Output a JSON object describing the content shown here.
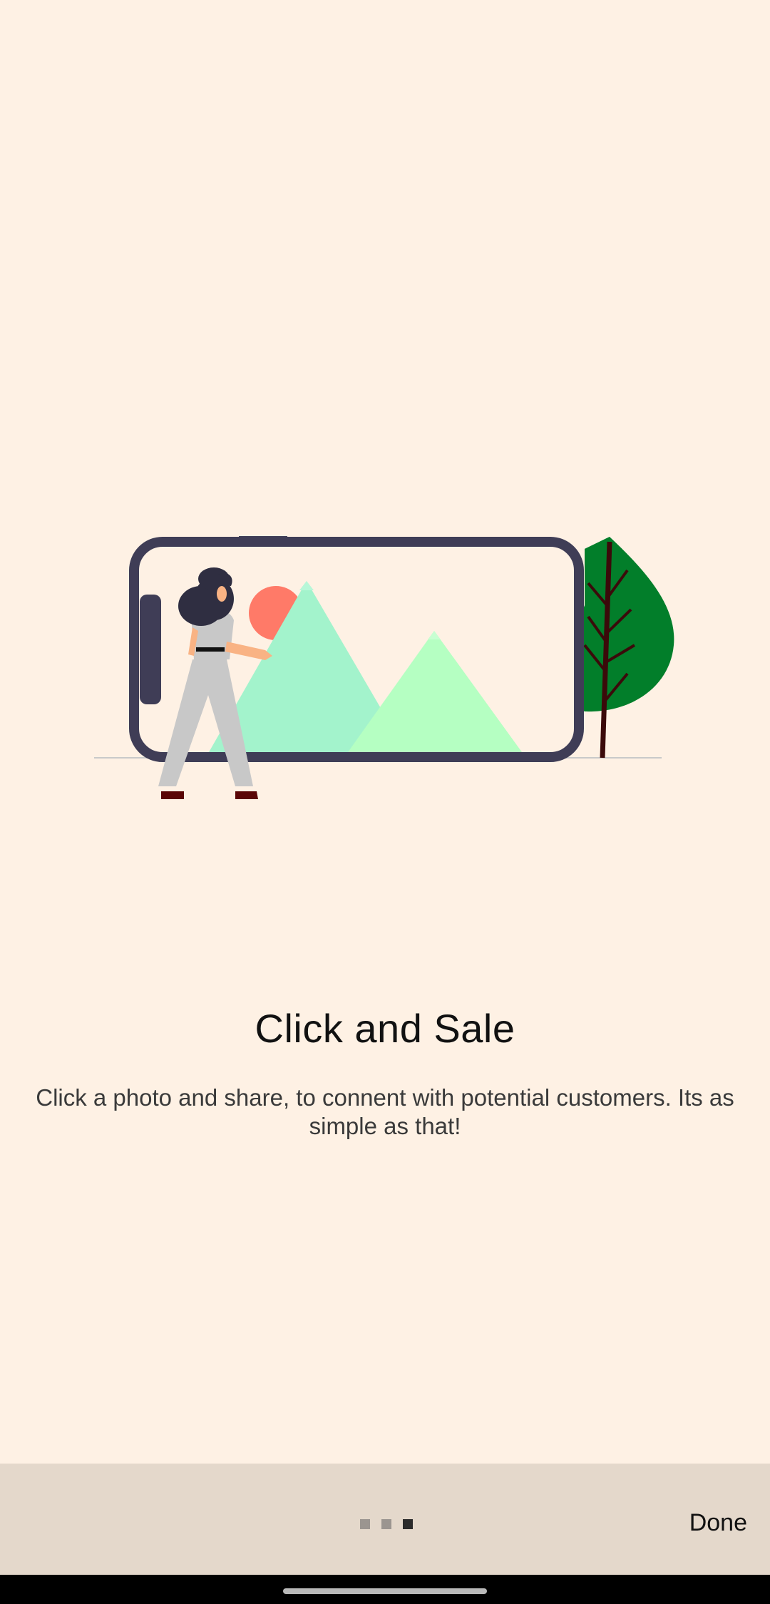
{
  "slide": {
    "title": "Click and Sale",
    "description": "Click a photo and share, to connent with potential customers. Its as simple as that!"
  },
  "pager": {
    "total_pages": 3,
    "current_page": 3
  },
  "footer": {
    "done_label": "Done"
  },
  "colors": {
    "background": "#FEF1E4",
    "bottom_bar": "#E4D8CB",
    "phone_frame": "#3F3D56",
    "sun": "#FF7A68",
    "mountain_left": "#A3F3CC",
    "mountain_right": "#B5FFC2",
    "tree": "#027E2A"
  },
  "illustration": {
    "name": "woman-with-phone-photo-illustration"
  }
}
